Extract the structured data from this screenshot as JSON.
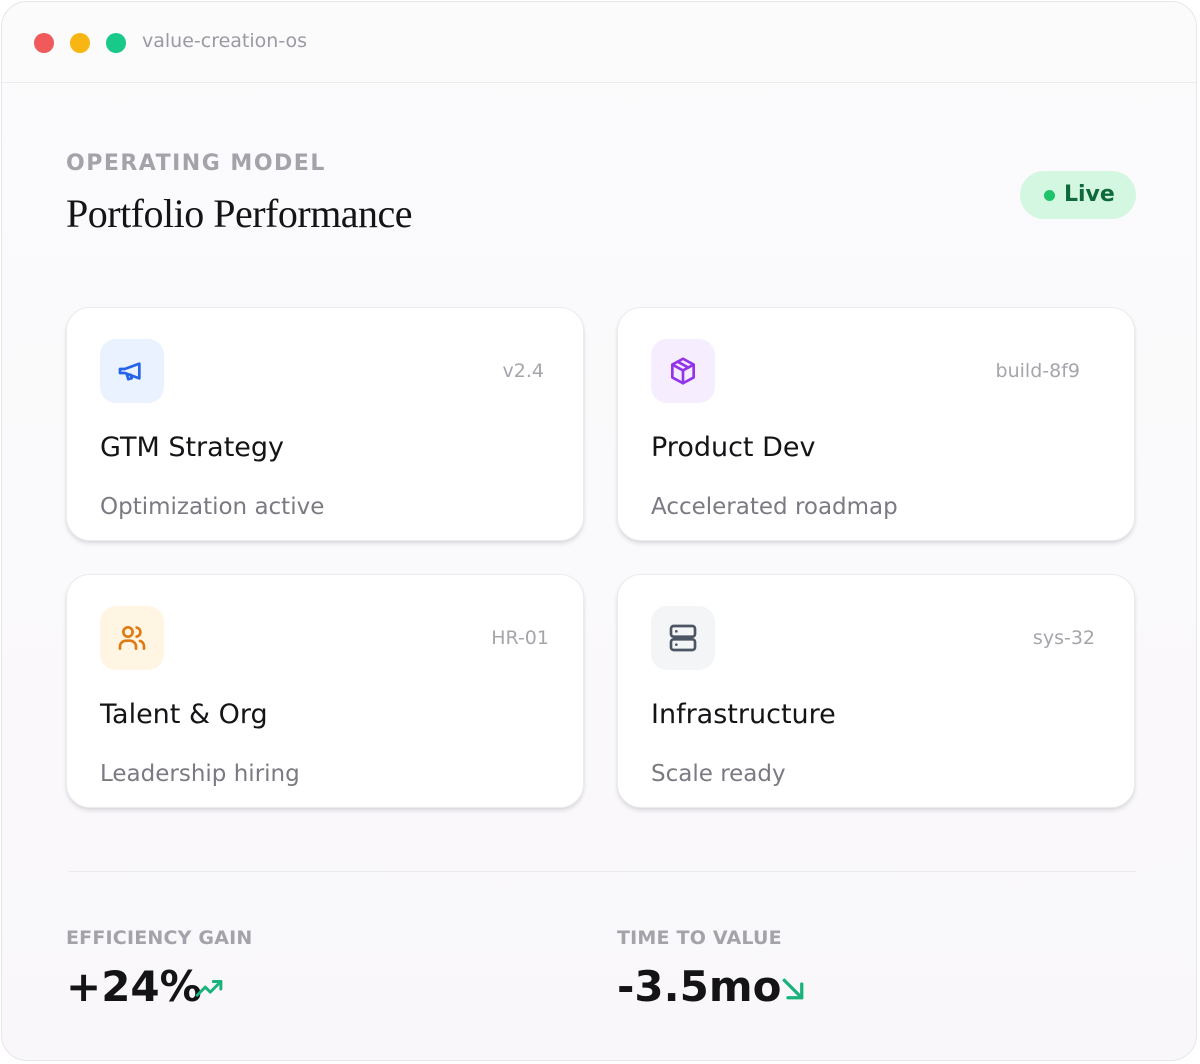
{
  "window": {
    "title": "value-creation-os",
    "controls": {
      "close_color": "#f05a5a",
      "minimize_color": "#f7b611",
      "maximize_color": "#19c98a"
    }
  },
  "header": {
    "eyebrow": "OPERATING MODEL",
    "title": "Portfolio Performance",
    "status_badge": {
      "label": "Live",
      "dot_color": "#1ec46a",
      "background": "#d4f7e1"
    }
  },
  "cards": [
    {
      "title": "GTM Strategy",
      "subtitle": "Optimization active",
      "tag": "v2.4",
      "icon": "megaphone-icon",
      "icon_color": "#2563eb",
      "icon_background": "#eaf2ff"
    },
    {
      "title": "Product Dev",
      "subtitle": "Accelerated roadmap",
      "tag": "build-8f9",
      "icon": "cube-icon",
      "icon_color": "#9333ea",
      "icon_background": "#f6eefe"
    },
    {
      "title": "Talent & Org",
      "subtitle": "Leadership hiring",
      "tag": "HR-01",
      "icon": "users-icon",
      "icon_color": "#e07a12",
      "icon_background": "#fff5e2"
    },
    {
      "title": "Infrastructure",
      "subtitle": "Scale ready",
      "tag": "sys-32",
      "icon": "server-icon",
      "icon_color": "#4b5563",
      "icon_background": "#f4f5f7"
    }
  ],
  "metrics": [
    {
      "label": "EFFICIENCY GAIN",
      "value": "+24%",
      "trend_icon": "trending-up-icon",
      "trend_color": "#19b27a"
    },
    {
      "label": "TIME TO VALUE",
      "value": "-3.5mo",
      "trend_icon": "arrow-down-right-icon",
      "trend_color": "#19b27a"
    }
  ]
}
